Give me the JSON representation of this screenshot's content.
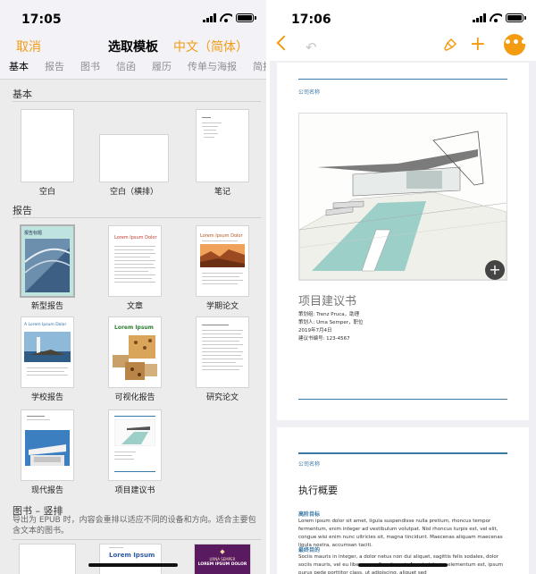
{
  "left": {
    "status": {
      "time": "17:05"
    },
    "nav": {
      "cancel": "取消",
      "title": "选取模板",
      "language": "中文（简体）"
    },
    "category_tabs": [
      "基本",
      "报告",
      "图书",
      "信函",
      "履历",
      "传单与海报",
      "简报"
    ],
    "sections": {
      "basic": {
        "heading": "基本",
        "templates": [
          "空白",
          "空白（横排）",
          "笔记"
        ]
      },
      "report": {
        "heading": "报告",
        "templates": [
          "新型报告",
          "文章",
          "学期论文",
          "学校报告",
          "可视化报告",
          "研究论文",
          "现代报告",
          "项目建议书"
        ]
      },
      "book": {
        "heading": "图书 – 竖排",
        "description": "导出为 EPUB 时，内容会重排以适应不同的设备和方向。适合主要包含文本的图书。"
      }
    },
    "thumb_text": {
      "report_title": "报告标题",
      "article_title": "Lorem Ipsum Dolor",
      "term_title": "Lorem Ipsum Dolor",
      "school_title": "A Lorem Ipsum Dolor",
      "visual_title": "Lorem Ipsum",
      "book2_title": "Lorem Ipsum",
      "book3_line1": "URNA SEMPER",
      "book3_line2": "LOREM IPSUM DOLOR"
    }
  },
  "right": {
    "status": {
      "time": "17:06"
    },
    "page1": {
      "company": "公司名称",
      "title": "项目建议书",
      "meta": [
        "策划组: Trenz Pruca，助理",
        "策划人: Uma Semper，职位",
        "2019年7月4日",
        "建议书编号: 123-4567"
      ]
    },
    "page2": {
      "company": "公司名称",
      "heading": "执行概要",
      "sub1": "高阶目标",
      "para1": "Lorem ipsum dolor sit amet, ligula suspendisse nulla pretium, rhoncus tempor fermentum, enim integer ad vestibulum volutpat. Nisl rhoncus turpis est, vel elit, congue wisi enim nunc ultricies sit, magna tincidunt. Maecenas aliquam maecenas ligula nostra, accumsan taciti.",
      "sub2": "最终目的",
      "para2": "Sociis mauris in integer, a dolor netus non dui aliquet, sagittis felis sodales, dolor sociis mauris, vel eu libero cras. Faucibus at. Arcu habitasse elementum est, ipsum purus pede porttitor class, ut adipiscing, aliquet sed"
    },
    "icons": [
      "back-chevron-icon",
      "undo-icon",
      "paintbrush-icon",
      "plus-icon",
      "more-icon",
      "add-image-icon"
    ]
  },
  "colors": {
    "accent": "#f39c12",
    "link_blue": "#3a78a6",
    "pool": "#9ccfc7"
  }
}
